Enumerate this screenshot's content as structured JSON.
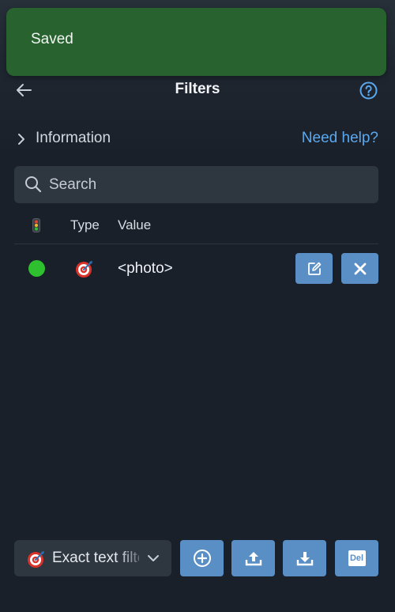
{
  "toast": {
    "message": "Saved",
    "color": "#27622f"
  },
  "header": {
    "title": "Filters",
    "back_icon": "arrow-left-icon",
    "help_icon": "question-circle-icon"
  },
  "info": {
    "label": "Information",
    "help_link": "Need help?",
    "chevron_icon": "chevron-right-icon"
  },
  "search": {
    "placeholder": "Search",
    "value": ""
  },
  "table": {
    "columns": {
      "status_icon": "traffic-light-icon",
      "type": "Type",
      "value": "Value"
    },
    "rows": [
      {
        "status": "enabled",
        "status_color": "#2ec02e",
        "type_icon": "target-dart-icon",
        "value": "<photo>",
        "actions": [
          "edit-icon",
          "close-icon"
        ]
      }
    ]
  },
  "footer": {
    "selected_type": "Exact text filter",
    "selected_type_icon": "target-dart-icon",
    "buttons": {
      "add_icon": "plus-circle-icon",
      "upload_icon": "upload-icon",
      "download_icon": "download-icon",
      "delete_label": "Del"
    }
  },
  "colors": {
    "accent": "#5a8fc6",
    "link": "#5aa9f0",
    "background": "#1a202a"
  }
}
